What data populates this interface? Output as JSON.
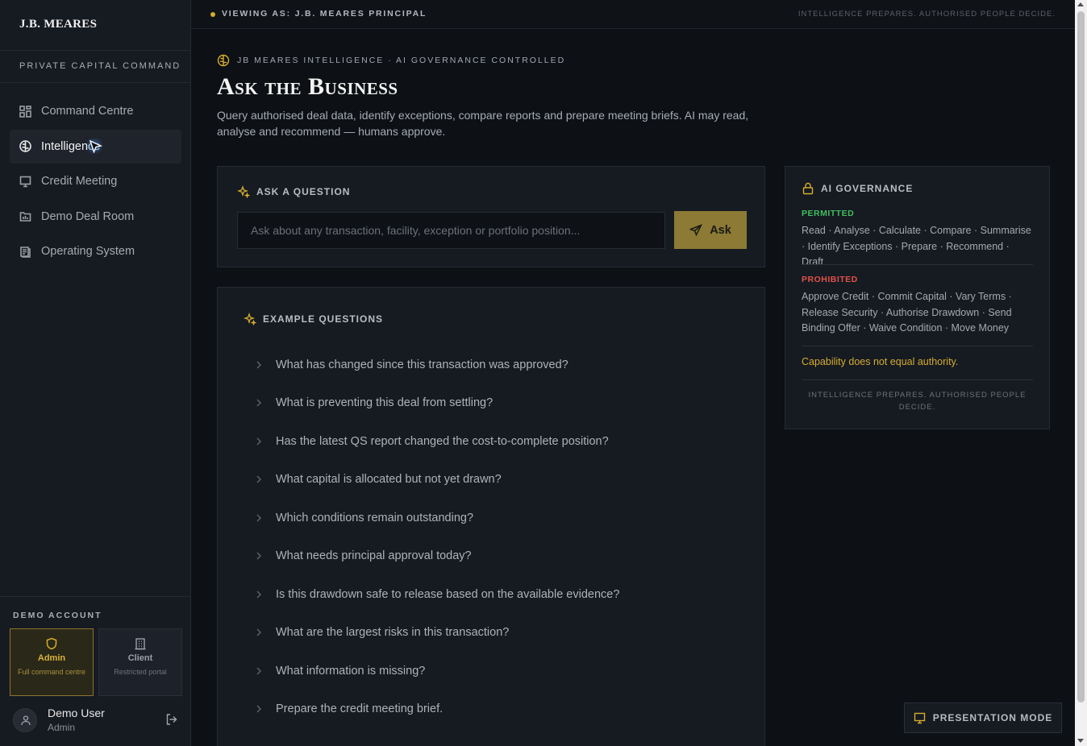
{
  "brand": {
    "logo": "J.B. MEARES",
    "subtitle": "PRIVATE CAPITAL COMMAND"
  },
  "nav": [
    {
      "label": "Command Centre",
      "icon": "grid-icon"
    },
    {
      "label": "Intelligence",
      "icon": "brain-icon",
      "active": true
    },
    {
      "label": "Credit Meeting",
      "icon": "presentation-icon"
    },
    {
      "label": "Demo Deal Room",
      "icon": "folder-icon"
    },
    {
      "label": "Operating System",
      "icon": "book-icon"
    }
  ],
  "demo": {
    "label": "DEMO ACCOUNT",
    "roles": [
      {
        "title": "Admin",
        "sub": "Full command centre",
        "icon": "shield-icon",
        "selected": true
      },
      {
        "title": "Client",
        "sub": "Restricted portal",
        "icon": "building-icon"
      }
    ],
    "user": {
      "name": "Demo User",
      "role": "Admin"
    }
  },
  "topbar": {
    "viewing": "VIEWING AS: J.B. MEARES PRINCIPAL",
    "tagline": "INTELLIGENCE PREPARES. AUTHORISED PEOPLE DECIDE."
  },
  "page": {
    "kicker": "JB MEARES INTELLIGENCE · AI GOVERNANCE CONTROLLED",
    "title": "Ask the Business",
    "description": "Query authorised deal data, identify exceptions, compare reports and prepare meeting briefs. AI may read, analyse and recommend — humans approve."
  },
  "ask": {
    "heading": "ASK A QUESTION",
    "placeholder": "Ask about any transaction, facility, exception or portfolio position...",
    "button": "Ask"
  },
  "examples": {
    "heading": "EXAMPLE QUESTIONS",
    "questions": [
      "What has changed since this transaction was approved?",
      "What is preventing this deal from settling?",
      "Has the latest QS report changed the cost-to-complete position?",
      "What capital is allocated but not yet drawn?",
      "Which conditions remain outstanding?",
      "What needs principal approval today?",
      "Is this drawdown safe to release based on the available evidence?",
      "What are the largest risks in this transaction?",
      "What information is missing?",
      "Prepare the credit meeting brief."
    ]
  },
  "governance": {
    "heading": "AI GOVERNANCE",
    "permitted_label": "PERMITTED",
    "permitted": "Read · Analyse · Calculate · Compare · Summarise · Identify Exceptions · Prepare · Recommend · Draft",
    "prohibited_label": "PROHIBITED",
    "prohibited": "Approve Credit · Commit Capital · Vary Terms · Release Security · Authorise Drawdown · Send Binding Offer · Waive Condition · Move Money",
    "note": "Capability does not equal authority.",
    "footer": "INTELLIGENCE PREPARES. AUTHORISED PEOPLE DECIDE."
  },
  "presentation_button": "PRESENTATION MODE",
  "colors": {
    "accent": "#d4ad2e",
    "permitted": "#3fbf5f",
    "prohibited": "#e0524a",
    "background": "#0d1014"
  }
}
